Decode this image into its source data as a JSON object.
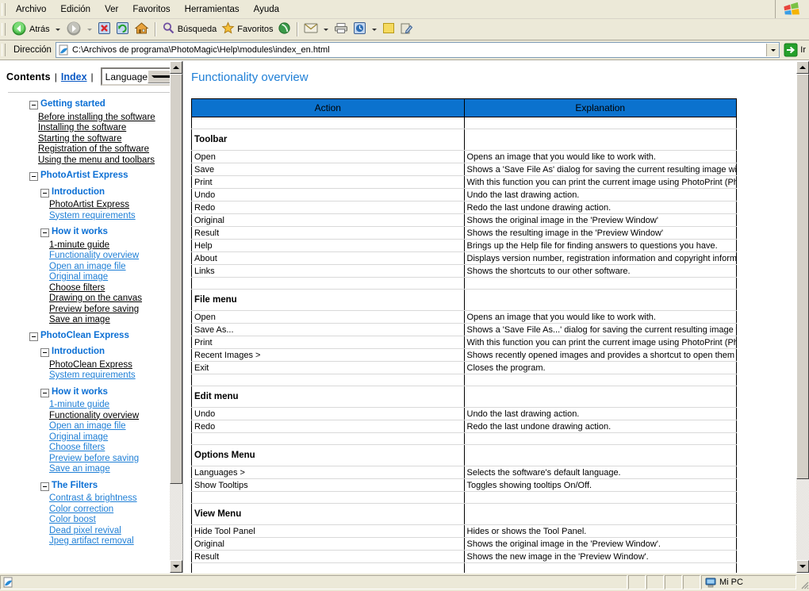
{
  "window": {
    "menu": [
      "Archivo",
      "Edición",
      "Ver",
      "Favoritos",
      "Herramientas",
      "Ayuda"
    ],
    "brand_icon": "windows-flag-icon"
  },
  "toolbar": {
    "back_label": "Atrás",
    "search_label": "Búsqueda",
    "favorites_label": "Favoritos",
    "icons": [
      "back-icon",
      "forward-icon",
      "stop-icon",
      "refresh-icon",
      "home-icon",
      "search-icon",
      "favorites-star-icon",
      "media-icon",
      "mail-icon",
      "print-icon",
      "history-icon",
      "notes-icon",
      "edit-icon"
    ]
  },
  "address": {
    "label": "Dirección",
    "value": "C:\\Archivos de programa\\PhotoMagic\\Help\\modules\\index_en.html",
    "go_label": "Ir",
    "page_icon": "ie-page-icon"
  },
  "sidebar": {
    "contents_label": "Contents",
    "separator": "|",
    "index_label": "Index",
    "language_label": "Language",
    "tree": [
      {
        "type": "group",
        "level": 1,
        "label": "Getting started"
      },
      {
        "type": "leaves",
        "level": 1,
        "items": [
          {
            "label": "Before installing the software",
            "color": "black"
          },
          {
            "label": "Installing the software",
            "color": "black"
          },
          {
            "label": "Starting the software",
            "color": "black"
          },
          {
            "label": "Registration of the software",
            "color": "black"
          },
          {
            "label": "Using the menu and toolbars",
            "color": "black"
          }
        ]
      },
      {
        "type": "group",
        "level": 1,
        "label": "PhotoArtist Express"
      },
      {
        "type": "group",
        "level": 2,
        "label": "Introduction"
      },
      {
        "type": "leaves",
        "level": 2,
        "items": [
          {
            "label": "PhotoArtist Express",
            "color": "black"
          },
          {
            "label": "System requirements",
            "color": "blue"
          }
        ]
      },
      {
        "type": "group",
        "level": 2,
        "label": "How it works"
      },
      {
        "type": "leaves",
        "level": 2,
        "items": [
          {
            "label": "1-minute guide",
            "color": "black"
          },
          {
            "label": "Functionality overview",
            "color": "blue"
          },
          {
            "label": "Open an image file",
            "color": "blue"
          },
          {
            "label": "Original image",
            "color": "blue"
          },
          {
            "label": "Choose filters",
            "color": "black"
          },
          {
            "label": "Drawing on the canvas",
            "color": "black"
          },
          {
            "label": "Preview before saving",
            "color": "black"
          },
          {
            "label": "Save an image",
            "color": "black"
          }
        ]
      },
      {
        "type": "group",
        "level": 1,
        "label": "PhotoClean Express"
      },
      {
        "type": "group",
        "level": 2,
        "label": "Introduction"
      },
      {
        "type": "leaves",
        "level": 2,
        "items": [
          {
            "label": "PhotoClean Express",
            "color": "black"
          },
          {
            "label": "System requirements",
            "color": "blue"
          }
        ]
      },
      {
        "type": "group",
        "level": 2,
        "label": "How it works"
      },
      {
        "type": "leaves",
        "level": 2,
        "items": [
          {
            "label": "1-minute guide",
            "color": "blue"
          },
          {
            "label": "Functionality overview",
            "color": "black"
          },
          {
            "label": "Open an image file",
            "color": "blue"
          },
          {
            "label": "Original image",
            "color": "blue"
          },
          {
            "label": "Choose filters",
            "color": "blue"
          },
          {
            "label": "Preview before saving",
            "color": "blue"
          },
          {
            "label": "Save an image",
            "color": "blue"
          }
        ]
      },
      {
        "type": "group",
        "level": 2,
        "label": "The Filters"
      },
      {
        "type": "leaves",
        "level": 2,
        "items": [
          {
            "label": "Contrast & brightness",
            "color": "blue"
          },
          {
            "label": "Color correction",
            "color": "blue"
          },
          {
            "label": "Color boost",
            "color": "blue"
          },
          {
            "label": "Dead pixel revival",
            "color": "blue"
          },
          {
            "label": "Jpeg artifact removal",
            "color": "blue"
          }
        ]
      }
    ]
  },
  "document": {
    "title": "Functionality overview",
    "table": {
      "headers": [
        "Action",
        "Explanation"
      ],
      "header_bg": "#0b72ce",
      "rows": [
        {
          "kind": "spacer",
          "action": "",
          "explanation": ""
        },
        {
          "kind": "section",
          "action": "Toolbar",
          "explanation": ""
        },
        {
          "kind": "row",
          "action": "Open",
          "explanation": "Opens an image that you would like to work with."
        },
        {
          "kind": "row",
          "action": "Save",
          "explanation": "Shows a 'Save File As' dialog for saving the current resulting image with a new name."
        },
        {
          "kind": "row",
          "action": "Print",
          "explanation": "With this function you can print the current image using PhotoPrint (PhotoPrint installation required)."
        },
        {
          "kind": "row",
          "action": "Undo",
          "explanation": "Undo the last drawing action."
        },
        {
          "kind": "row",
          "action": "Redo",
          "explanation": "Redo the last undone drawing action."
        },
        {
          "kind": "row",
          "action": "Original",
          "explanation": "Shows the original image in the 'Preview Window'"
        },
        {
          "kind": "row",
          "action": "Result",
          "explanation": "Shows the resulting image in the 'Preview Window'"
        },
        {
          "kind": "row",
          "action": "Help",
          "explanation": "Brings up the Help file for finding answers to questions you have."
        },
        {
          "kind": "row",
          "action": "About",
          "explanation": "Displays version number, registration information and copyright information of the program."
        },
        {
          "kind": "row",
          "action": "Links",
          "explanation": "Shows the shortcuts to our other software."
        },
        {
          "kind": "spacer",
          "action": "",
          "explanation": ""
        },
        {
          "kind": "section",
          "action": "File menu",
          "explanation": ""
        },
        {
          "kind": "row",
          "action": "Open",
          "explanation": "Opens an image that you would like to work with."
        },
        {
          "kind": "row",
          "action": "Save As...",
          "explanation": "Shows a 'Save File As...' dialog for saving the current resulting image with a new name."
        },
        {
          "kind": "row",
          "action": "Print",
          "explanation": "With this function you can print the current image using PhotoPrint (PhotoPrint installation required)."
        },
        {
          "kind": "row",
          "action": "Recent Images >",
          "explanation": "Shows recently opened images and provides a shortcut to open them instantly."
        },
        {
          "kind": "row",
          "action": "Exit",
          "explanation": "Closes the program."
        },
        {
          "kind": "spacer",
          "action": "",
          "explanation": ""
        },
        {
          "kind": "section",
          "action": "Edit menu",
          "explanation": ""
        },
        {
          "kind": "row",
          "action": "Undo",
          "explanation": "Undo the last drawing action."
        },
        {
          "kind": "row",
          "action": "Redo",
          "explanation": "Redo the last undone drawing action."
        },
        {
          "kind": "spacer",
          "action": "",
          "explanation": ""
        },
        {
          "kind": "section",
          "action": "Options Menu",
          "explanation": ""
        },
        {
          "kind": "row",
          "action": "Languages >",
          "explanation": "Selects the software's default language."
        },
        {
          "kind": "row",
          "action": "Show Tooltips",
          "explanation": "Toggles showing tooltips On/Off."
        },
        {
          "kind": "spacer",
          "action": "",
          "explanation": ""
        },
        {
          "kind": "section",
          "action": "View Menu",
          "explanation": ""
        },
        {
          "kind": "row",
          "action": "Hide Tool Panel",
          "explanation": "Hides or shows the Tool Panel."
        },
        {
          "kind": "row",
          "action": "Original",
          "explanation": "Shows the original image in the 'Preview Window'."
        },
        {
          "kind": "row",
          "action": "Result",
          "explanation": "Shows the new image in the 'Preview Window'."
        },
        {
          "kind": "spacer",
          "action": "",
          "explanation": ""
        }
      ]
    }
  },
  "statusbar": {
    "text": "",
    "zone_label": "Mi PC",
    "zone_icon": "my-computer-icon",
    "page_icon": "ie-page-icon"
  }
}
